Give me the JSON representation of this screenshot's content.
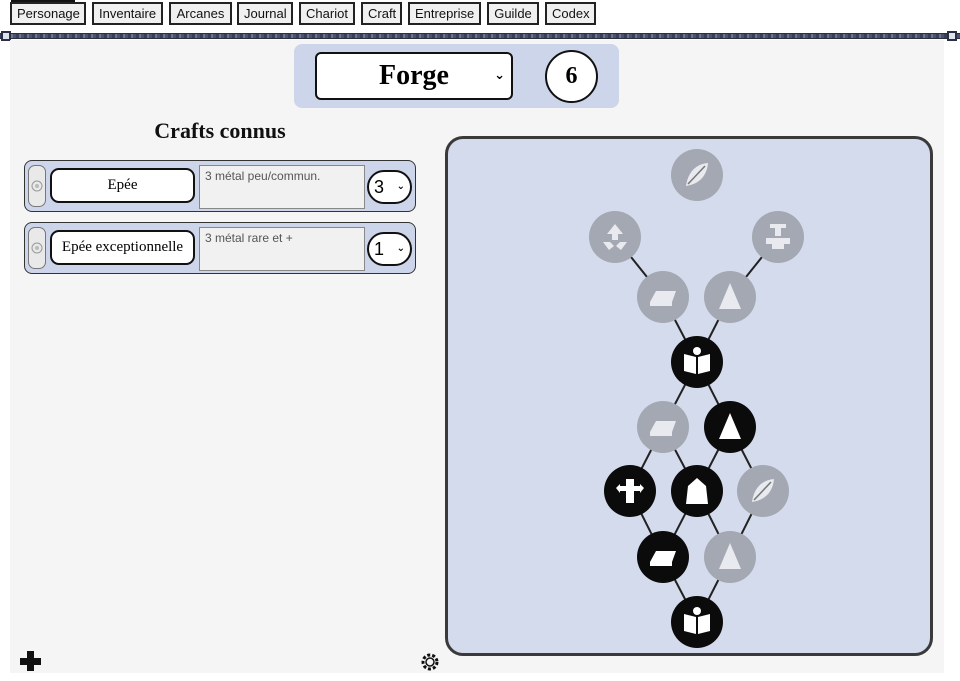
{
  "nav": {
    "tabs": [
      "Personage",
      "Inventaire",
      "Arcanes",
      "Journal",
      "Chariot",
      "Craft",
      "Entreprise",
      "Guilde",
      "Codex"
    ],
    "active": "Personage"
  },
  "metier": {
    "selected": "Forge",
    "level": "6"
  },
  "crafts": {
    "title": "Crafts connus",
    "items": [
      {
        "name": "Epée",
        "cost": "3 métal peu/commun.",
        "qty": "3"
      },
      {
        "name": "Epée exceptionnelle",
        "cost": "3 métal rare et +",
        "qty": "1"
      }
    ]
  },
  "tree": {
    "colors": {
      "unlocked": "#0b0b0b",
      "locked": "#a4a8b2",
      "panel": "#d4dbed"
    },
    "nodes": [
      {
        "icon": "feather-leaf-icon",
        "unlocked": false
      },
      {
        "icon": "recycle-icon",
        "unlocked": false
      },
      {
        "icon": "anvil-hammer-icon",
        "unlocked": false
      },
      {
        "icon": "metal-ingot-icon",
        "unlocked": false
      },
      {
        "icon": "cone-weight-icon",
        "unlocked": false
      },
      {
        "icon": "open-book-icon",
        "unlocked": true
      },
      {
        "icon": "metal-ingot-icon",
        "unlocked": false
      },
      {
        "icon": "cone-weight-icon",
        "unlocked": true
      },
      {
        "icon": "armored-figure-icon",
        "unlocked": true
      },
      {
        "icon": "cloak-armor-icon",
        "unlocked": true
      },
      {
        "icon": "feather-leaf-icon",
        "unlocked": false
      },
      {
        "icon": "metal-ingot-icon",
        "unlocked": true
      },
      {
        "icon": "cone-weight-icon",
        "unlocked": false
      },
      {
        "icon": "open-book-icon",
        "unlocked": true
      }
    ]
  },
  "footer": {
    "left_icon": "add-cross-icon",
    "right_icon": "settings-gear-icon"
  }
}
